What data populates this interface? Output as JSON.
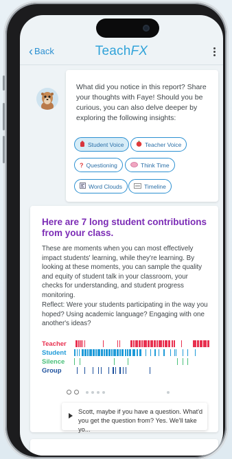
{
  "header": {
    "back_label": "Back",
    "brand_part1": "Teach",
    "brand_part2": "FX"
  },
  "intro_message": "What did you notice in this report? Share your thoughts with Faye! Should you be curious, you can also delve deeper by exploring the following insights:",
  "insight_buttons": [
    {
      "label": "Student Voice",
      "icon": "student-voice-icon",
      "active": true
    },
    {
      "label": "Teacher Voice",
      "icon": "teacher-voice-icon",
      "active": false
    },
    {
      "label": "Questioning",
      "icon": "question-icon",
      "active": false
    },
    {
      "label": "Think Time",
      "icon": "brain-icon",
      "active": false
    },
    {
      "label": "Word Clouds",
      "icon": "word-cloud-icon",
      "active": false
    },
    {
      "label": "Timeline",
      "icon": "timeline-icon",
      "active": false
    }
  ],
  "report": {
    "heading": "Here are 7 long student contributions from your class.",
    "paragraph1": "These are moments when you can most effectively impact students' learning, while they're learning. By looking at these moments, you can sample the quality and equity of student talk in your classroom, your checks for understanding, and student progress monitoring.",
    "paragraph2": "Reflect: Were your students participating in the way you hoped? Using academic language? Engaging with one another's ideas?",
    "legend": {
      "teacher": "Teacher",
      "student": "Student",
      "silence": "Silence",
      "group": "Group"
    },
    "colors": {
      "teacher": "#e8304f",
      "student": "#1e9ad8",
      "silence": "#49c07a",
      "group": "#1c4f9c",
      "heading": "#7b2bb5"
    },
    "quote": "Scott, maybe if you have a question. What'd you get the question from? Yes. We'll take yo..."
  }
}
